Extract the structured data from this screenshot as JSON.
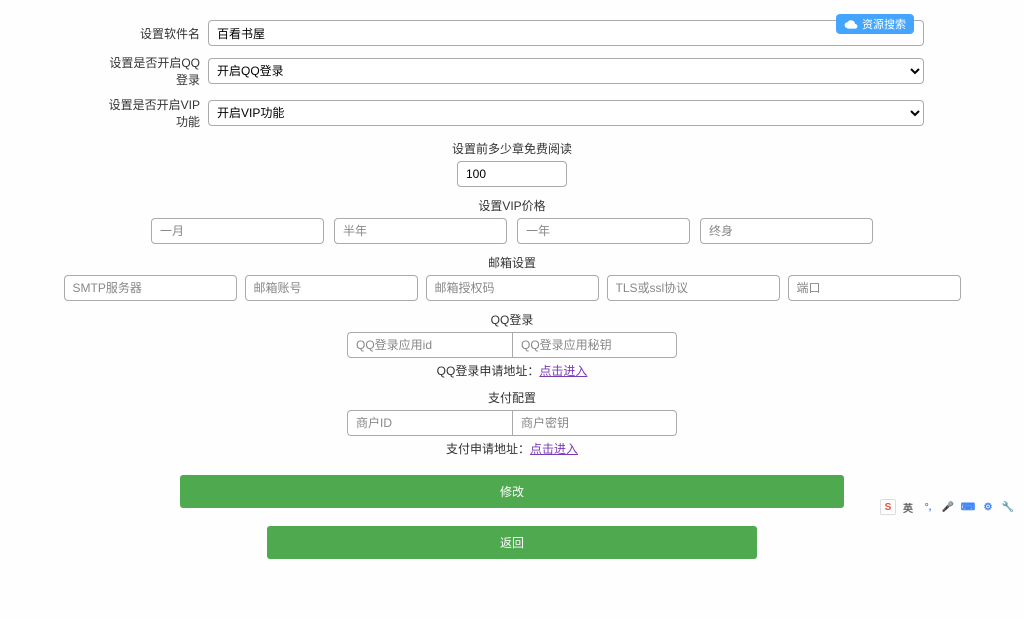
{
  "topBadge": "资源搜索",
  "labels": {
    "softwareName": "设置软件名",
    "qqLoginToggle": "设置是否开启QQ登录",
    "vipToggle": "设置是否开启VIP功能",
    "freeChapters": "设置前多少章免费阅读",
    "vipPrice": "设置VIP价格",
    "emailSettings": "邮箱设置",
    "qqLogin": "QQ登录",
    "payConfig": "支付配置"
  },
  "values": {
    "softwareName": "百看书屋",
    "freeChapters": "100"
  },
  "selects": {
    "qqLogin": "开启QQ登录",
    "vip": "开启VIP功能"
  },
  "placeholders": {
    "vip": [
      "一月",
      "半年",
      "一年",
      "终身"
    ],
    "email": [
      "SMTP服务器",
      "邮箱账号",
      "邮箱授权码",
      "TLS或ssl协议",
      "端口"
    ],
    "qq": [
      "QQ登录应用id",
      "QQ登录应用秘钥"
    ],
    "pay": [
      "商户ID",
      "商户密钥"
    ]
  },
  "hints": {
    "qqApplyPrefix": "QQ登录申请地址：",
    "payApplyPrefix": "支付申请地址：",
    "link": "点击进入"
  },
  "buttons": {
    "modify": "修改",
    "back": "返回"
  },
  "tray": {
    "s": "S",
    "lang": "英"
  }
}
